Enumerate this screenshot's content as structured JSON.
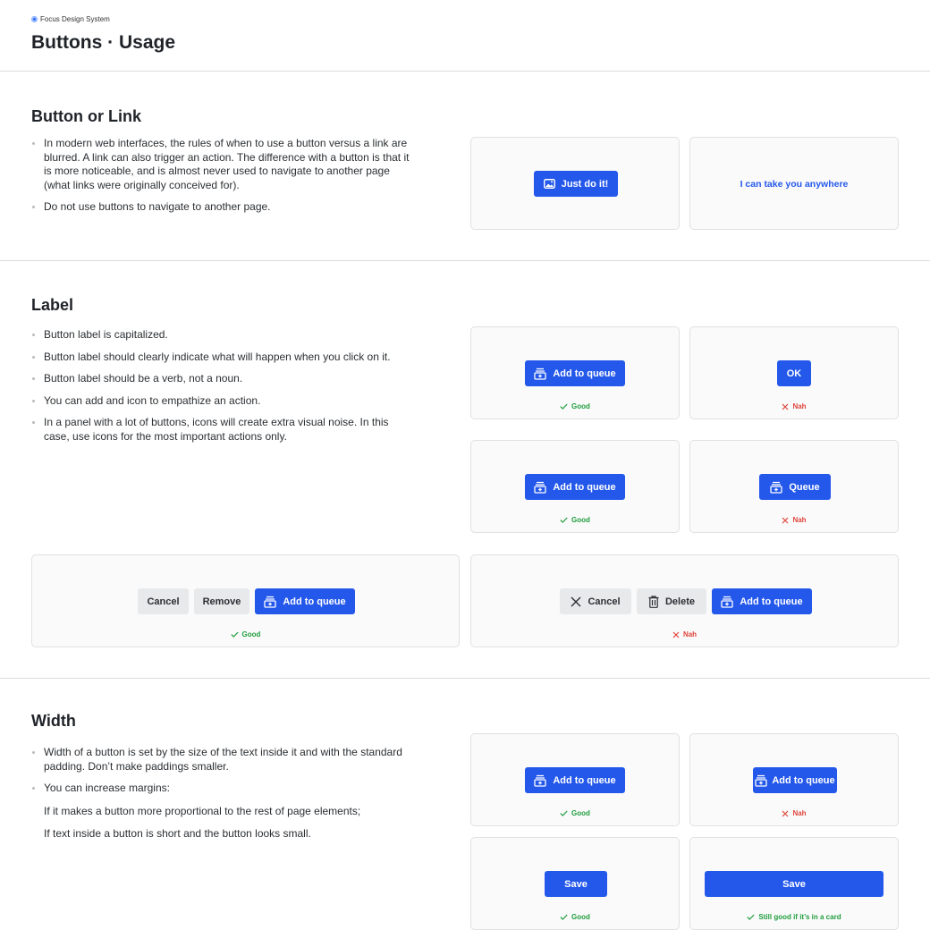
{
  "header": {
    "brand": "Focus Design System",
    "title": "Buttons · Usage"
  },
  "sections": {
    "button_or_link": {
      "title": "Button or Link",
      "bullets": [
        "In modern web interfaces, the rules of when to use a button versus a link are blurred. A link can also trigger an action. The difference with a button is that it is more noticeable, and is almost never used to navigate to another page (what links were originally conceived for).",
        "Do not use buttons to navigate to another page."
      ],
      "examples": {
        "button_label": "Just do it!",
        "button_icon": "image-icon",
        "link_label": "I can take you anywhere"
      }
    },
    "label": {
      "title": "Label",
      "bullets": [
        "Button label is capitalized.",
        "Button label should clearly indicate what will happen when you click on it.",
        "Button label should be a verb, not a noun.",
        "You can add and icon to empathize an action.",
        "In a panel with a lot of buttons, icons will create extra visual noise. In this case, use icons for the most important actions only."
      ],
      "examples": {
        "add_to_queue": "Add to queue",
        "ok": "OK",
        "queue": "Queue",
        "cancel": "Cancel",
        "remove": "Remove",
        "delete": "Delete",
        "queue_icon": "add-to-queue-icon",
        "cancel_icon": "close-icon",
        "delete_icon": "trash-icon"
      }
    },
    "width": {
      "title": "Width",
      "bullets": [
        "Width of a button is set by the size of the text inside it and with the standard padding. Don’t make paddings smaller.",
        "You can increase margins:"
      ],
      "sub_lines": [
        "If it makes a button more proportional to the rest of page elements;",
        "If text inside a button is short and the button looks small."
      ],
      "examples": {
        "add_to_queue": "Add to queue",
        "save": "Save"
      }
    }
  },
  "verdicts": {
    "good": "Good",
    "nah": "Nah",
    "still_good": "Still good if it’s in a card"
  },
  "colors": {
    "primary": "#2458eb",
    "good": "#1f9d3b",
    "bad": "#e0443a",
    "card_bg": "#fafafb",
    "card_border": "#dfe1e4"
  }
}
